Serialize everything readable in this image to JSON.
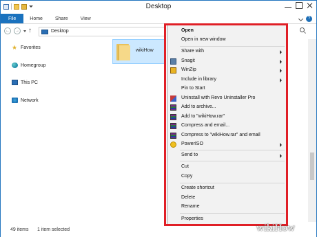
{
  "window": {
    "title": "Desktop"
  },
  "ribbon": {
    "tabs": [
      "File",
      "Home",
      "Share",
      "View"
    ],
    "help": "?"
  },
  "address": {
    "path": "Desktop"
  },
  "nav": {
    "items": [
      "Favorites",
      "Homegroup",
      "This PC",
      "Network"
    ]
  },
  "content": {
    "folder_name": "wikiHow"
  },
  "status": {
    "item_count": "49 items",
    "selected": "1 item selected"
  },
  "context_menu": {
    "items": [
      {
        "label": "Open",
        "bold": true,
        "icon": "",
        "submenu": false
      },
      {
        "label": "Open in new window",
        "icon": "",
        "submenu": false
      },
      {
        "label": "Share with",
        "icon": "",
        "submenu": true
      },
      {
        "label": "Snagit",
        "icon": "snagit-icon",
        "submenu": true
      },
      {
        "label": "WinZip",
        "icon": "winzip-icon",
        "submenu": true
      },
      {
        "label": "Include in library",
        "icon": "",
        "submenu": true
      },
      {
        "label": "Pin to Start",
        "icon": "",
        "submenu": false
      },
      {
        "label": "Uninstall with Revo Uninstaller Pro",
        "icon": "revo-uninstaller-icon",
        "submenu": false
      },
      {
        "label": "Add to archive...",
        "icon": "winrar-icon",
        "submenu": false
      },
      {
        "label": "Add to \"wikiHow.rar\"",
        "icon": "winrar-icon",
        "submenu": false
      },
      {
        "label": "Compress and email...",
        "icon": "winrar-icon",
        "submenu": false
      },
      {
        "label": "Compress to \"wikiHow.rar\" and email",
        "icon": "winrar-icon",
        "submenu": false
      },
      {
        "label": "PowerISO",
        "icon": "poweriso-icon",
        "submenu": true
      },
      {
        "label": "Send to",
        "icon": "",
        "submenu": true
      },
      {
        "label": "Cut",
        "icon": "",
        "submenu": false
      },
      {
        "label": "Copy",
        "icon": "",
        "submenu": false
      },
      {
        "label": "Create shortcut",
        "icon": "",
        "submenu": false
      },
      {
        "label": "Delete",
        "icon": "",
        "submenu": false
      },
      {
        "label": "Rename",
        "icon": "",
        "submenu": false
      },
      {
        "label": "Properties",
        "icon": "",
        "submenu": false
      }
    ]
  },
  "watermark": {
    "text": "wikiHow"
  },
  "colors": {
    "accent": "#1a72be",
    "highlight": "#e01f26",
    "selection": "#cce8ff"
  }
}
